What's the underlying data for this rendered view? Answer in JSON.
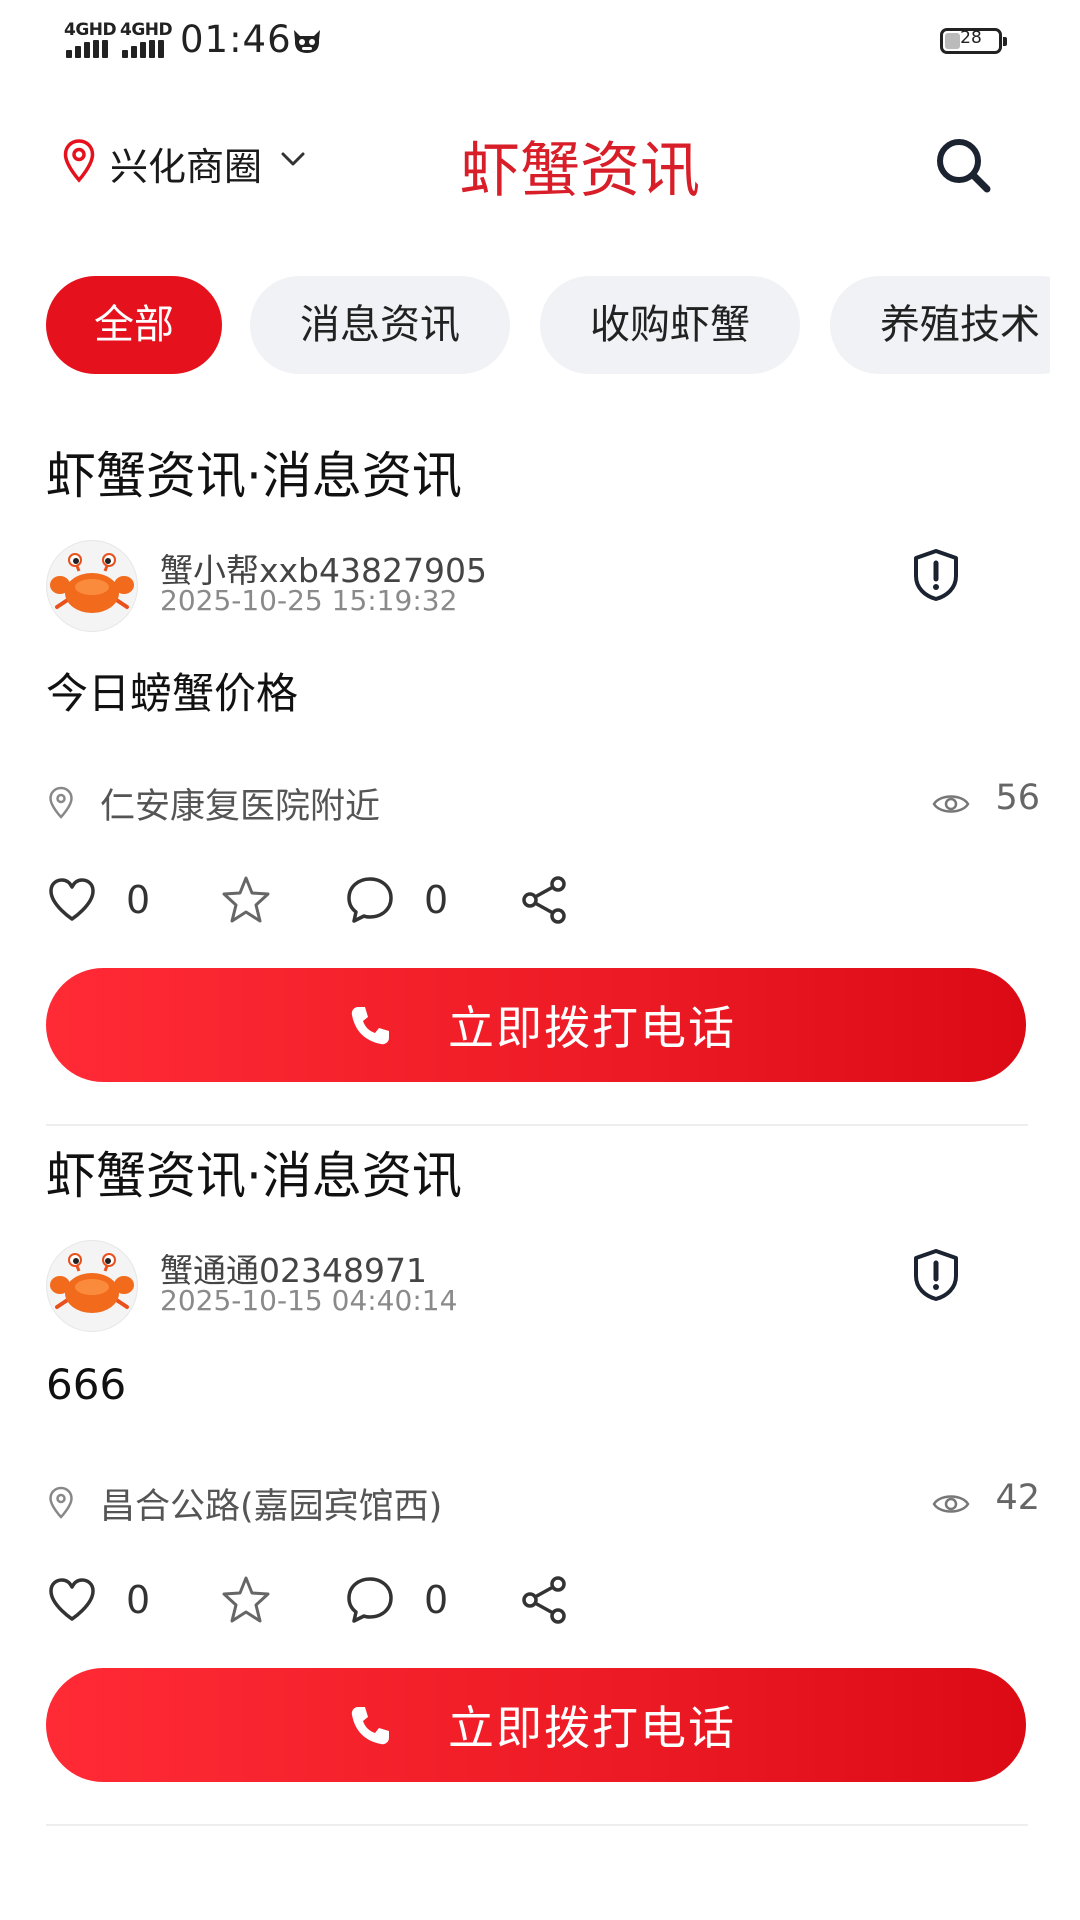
{
  "status_bar": {
    "sim1": "4GHD",
    "sim2": "4GHD",
    "time": "01:46",
    "battery_level": "28",
    "battery_level_fraction": 0.28
  },
  "header": {
    "location": "兴化商圈",
    "title": "虾蟹资讯",
    "title_color": "#d81e28",
    "icons": [
      "location-pin-icon",
      "chevron-down-icon",
      "search-icon"
    ]
  },
  "tabs": [
    {
      "label": "全部",
      "active": true
    },
    {
      "label": "消息资讯",
      "active": false
    },
    {
      "label": "收购虾蟹",
      "active": false
    },
    {
      "label": "养殖技术",
      "active": false
    }
  ],
  "posts": [
    {
      "category": "虾蟹资讯·消息资讯",
      "author": "蟹小帮xxb43827905",
      "time": "2025-10-25 15:19:32",
      "text": "今日螃蟹价格",
      "place": "仁安康复医院附近",
      "views": "56",
      "likes": "0",
      "comments": "0",
      "call_label": "立即拨打电话"
    },
    {
      "category": "虾蟹资讯·消息资讯",
      "author": "蟹通通02348971",
      "time": "2025-10-15 04:40:14",
      "text": "666",
      "place": "昌合公路(嘉园宾馆西)",
      "views": "42",
      "likes": "0",
      "comments": "0",
      "call_label": "立即拨打电话"
    }
  ],
  "colors": {
    "accent": "#e5121d",
    "tab_inactive_bg": "#f1f2f5",
    "call_gradient_start": "#ff2a35",
    "call_gradient_end": "#dc0a14"
  },
  "action_icons": [
    "heart-icon",
    "star-icon",
    "comment-icon",
    "share-icon"
  ]
}
